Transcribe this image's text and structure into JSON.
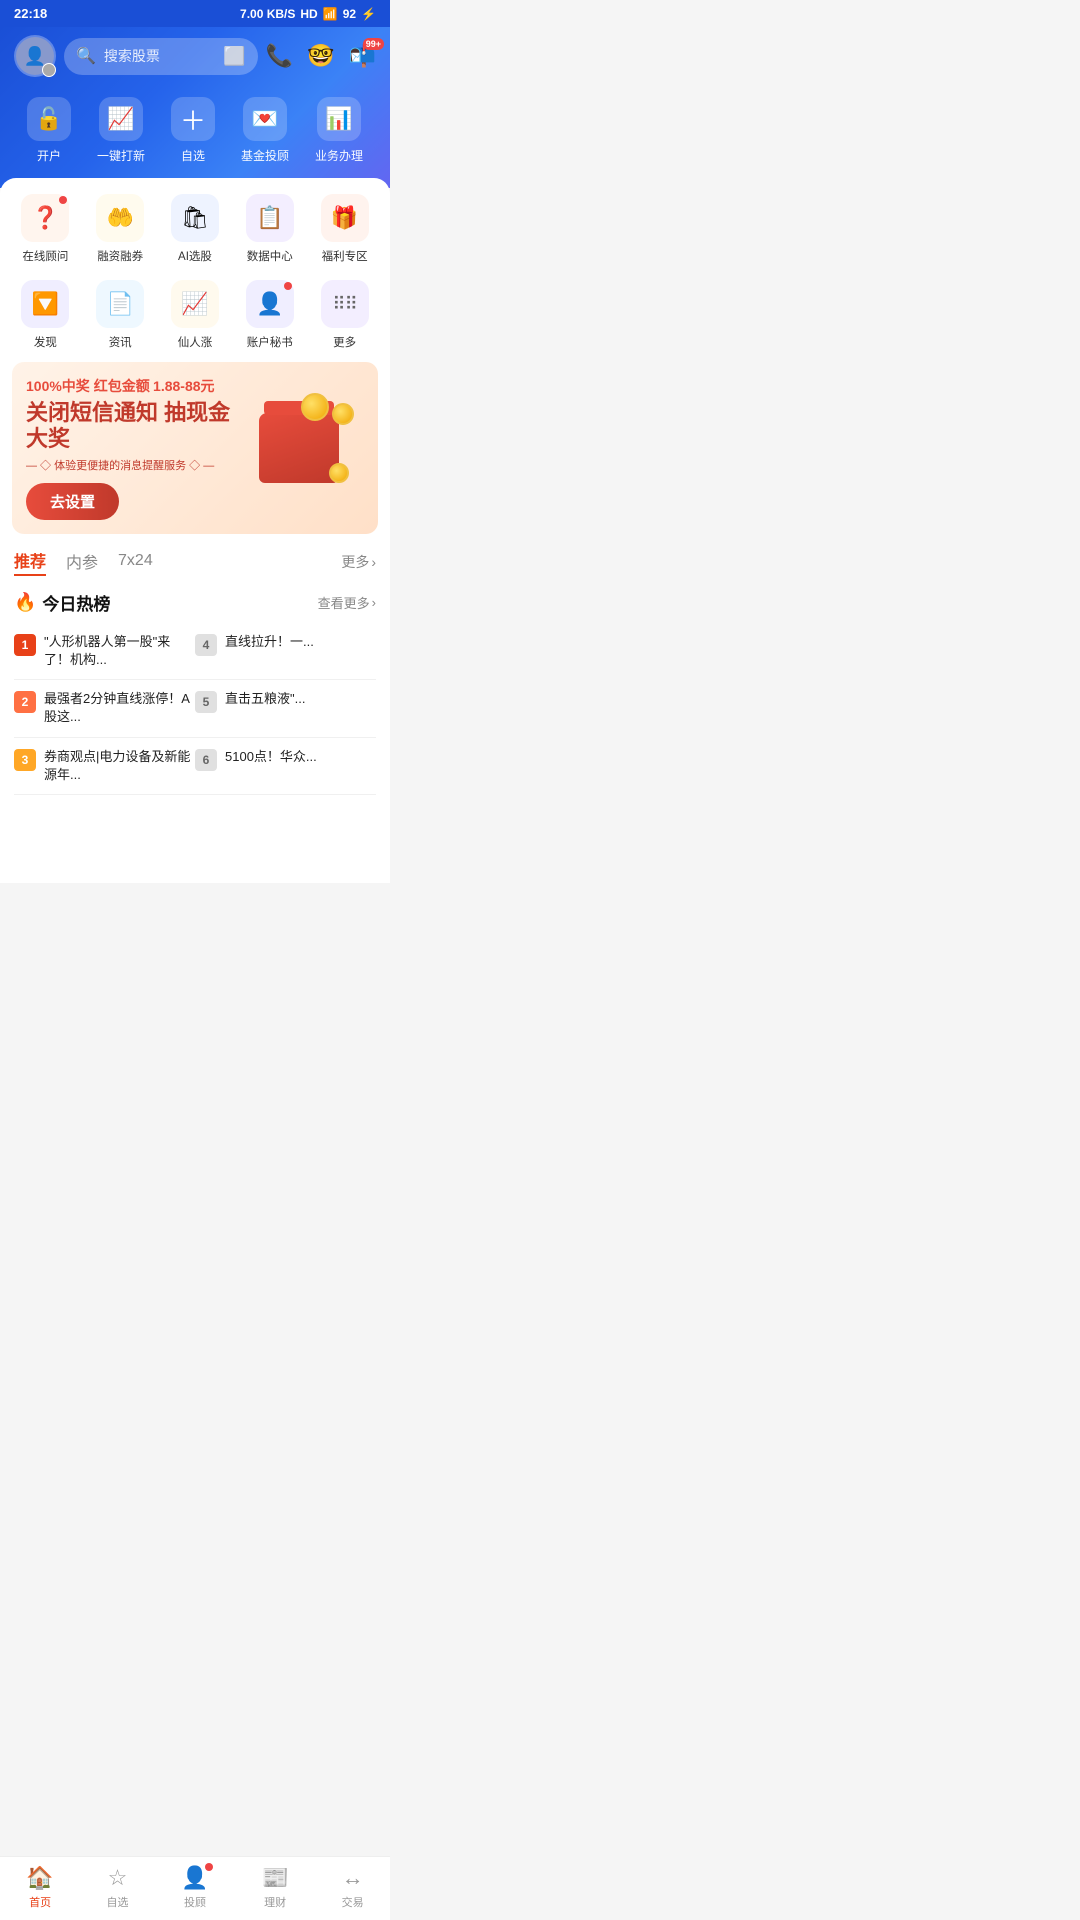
{
  "statusBar": {
    "time": "22:18",
    "network": "4G",
    "speed": "7.00 KB/S",
    "quality": "HD",
    "battery": "92"
  },
  "header": {
    "searchPlaceholder": "搜索股票",
    "notifCount": "99+"
  },
  "quickNav": [
    {
      "id": "open-account",
      "label": "开户",
      "icon": "🔓"
    },
    {
      "id": "one-click-new",
      "label": "一键打新",
      "icon": "📈"
    },
    {
      "id": "watchlist",
      "label": "自选",
      "icon": "➕"
    },
    {
      "id": "fund-advisor",
      "label": "基金投顾",
      "icon": "💌"
    },
    {
      "id": "business",
      "label": "业务办理",
      "icon": "📊"
    }
  ],
  "services": [
    {
      "id": "online-advisor",
      "label": "在线顾问",
      "icon": "❓",
      "bg": "orange-bg",
      "dot": true
    },
    {
      "id": "margin",
      "label": "融资融券",
      "icon": "🤲",
      "bg": "yellow-bg",
      "dot": false
    },
    {
      "id": "ai-stock",
      "label": "AI选股",
      "icon": "🛍",
      "bg": "blue-bg",
      "dot": false
    },
    {
      "id": "data-center",
      "label": "数据中心",
      "icon": "📋",
      "bg": "purple-bg",
      "dot": false
    },
    {
      "id": "welfare",
      "label": "福利专区",
      "icon": "🎁",
      "bg": "gift-bg",
      "dot": false
    },
    {
      "id": "discover",
      "label": "发现",
      "icon": "🔽",
      "bg": "violet-bg",
      "dot": false
    },
    {
      "id": "news",
      "label": "资讯",
      "icon": "📄",
      "bg": "teal-bg",
      "dot": false
    },
    {
      "id": "immortal-rise",
      "label": "仙人涨",
      "icon": "📈",
      "bg": "gold-bg",
      "dot": false
    },
    {
      "id": "account-sec",
      "label": "账户秘书",
      "icon": "👤",
      "bg": "violet-bg",
      "dot": true
    },
    {
      "id": "more",
      "label": "更多",
      "icon": "⠿",
      "bg": "purple-bg",
      "dot": false
    }
  ],
  "banner": {
    "topText1": "100%中奖 红包金额",
    "topTextHighlight": "1.88-88元",
    "mainText": "关闭短信通知 抽现金大奖",
    "subText": "— ◇ 体验更便捷的消息提醒服务 ◇ —",
    "btnLabel": "去设置"
  },
  "newsTabs": [
    {
      "id": "recommend",
      "label": "推荐",
      "active": true
    },
    {
      "id": "insider",
      "label": "内参",
      "active": false
    },
    {
      "id": "7x24",
      "label": "7x24",
      "active": false
    }
  ],
  "newsMore": "更多",
  "hotList": {
    "title": "今日热榜",
    "moreLabel": "查看更多",
    "items": [
      {
        "rank": 1,
        "text": "\"人形机器人第一股\"来了！机构..."
      },
      {
        "rank": 4,
        "text": "直线拉升！一..."
      },
      {
        "rank": 2,
        "text": "最强者2分钟直线涨停！A股这..."
      },
      {
        "rank": 5,
        "text": "直击五粮液\"..."
      },
      {
        "rank": 3,
        "text": "券商观点|电力设备及新能源年..."
      },
      {
        "rank": 6,
        "text": "5100点！华众..."
      }
    ]
  },
  "bottomNav": [
    {
      "id": "home",
      "label": "首页",
      "icon": "🏠",
      "active": true
    },
    {
      "id": "watchlist",
      "label": "自选",
      "icon": "📋",
      "active": false
    },
    {
      "id": "advisor",
      "label": "投顾",
      "icon": "👤",
      "active": false,
      "dot": true
    },
    {
      "id": "wealth",
      "label": "理财",
      "icon": "📰",
      "active": false
    },
    {
      "id": "trade",
      "label": "交易",
      "icon": "↔",
      "active": false
    }
  ]
}
